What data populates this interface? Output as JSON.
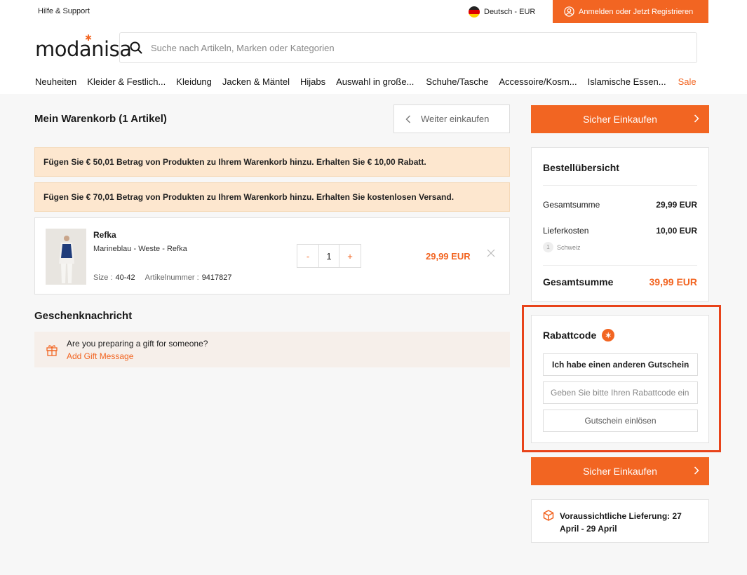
{
  "topbar": {
    "help": "Hilfe & Support",
    "language": "Deutsch - EUR",
    "login": "Anmelden oder Jetzt Registrieren",
    "accent": "#f26522"
  },
  "header": {
    "logo": "modanisa",
    "search_placeholder": "Suche nach Artikeln, Marken oder Kategorien",
    "nav": [
      "Neuheiten",
      "Kleider & Festlich...",
      "Kleidung",
      "Jacken & Mäntel",
      "Hijabs",
      "Auswahl in große...",
      "Schuhe/Tasche",
      "Accessoire/Kosm...",
      "Islamische Essen...",
      "Sale"
    ]
  },
  "cart": {
    "title": "Mein Warenkorb (1 Artikel)",
    "continue": "Weiter einkaufen",
    "banners": [
      "Fügen Sie € 50,01 Betrag von Produkten zu Ihrem Warenkorb hinzu. Erhalten Sie € 10,00 Rabatt.",
      "Fügen Sie € 70,01 Betrag von Produkten zu Ihrem Warenkorb hinzu. Erhalten Sie kostenlosen Versand."
    ],
    "item": {
      "brand": "Refka",
      "description": "Marineblau - Weste - Refka",
      "size_label": "Size :",
      "size": "40-42",
      "article_label": "Artikelnummer :",
      "article": "9417827",
      "minus": "-",
      "qty": "1",
      "plus": "+",
      "price": "29,99 EUR"
    }
  },
  "gift": {
    "title": "Geschenknachricht",
    "question": "Are you preparing a gift for someone?",
    "action": "Add Gift Message"
  },
  "summary": {
    "checkout": "Sicher Einkaufen",
    "title": "Bestellübersicht",
    "subtotal_label": "Gesamtsumme",
    "subtotal": "29,99 EUR",
    "shipping_label": "Lieferkosten",
    "shipping": "10,00 EUR",
    "shipping_count": "1",
    "shipping_country": "Schweiz",
    "total_label": "Gesamtsumme",
    "total": "39,99 EUR"
  },
  "coupon": {
    "title": "Rabattcode",
    "select_value": "Ich habe einen anderen Gutschein",
    "input_placeholder": "Geben Sie bitte Ihren Rabattcode ein",
    "redeem": "Gutschein einlösen",
    "highlight_color": "#e8431a"
  },
  "delivery": {
    "text": "Voraussichtliche Lieferung: 27 April - 29 April"
  }
}
